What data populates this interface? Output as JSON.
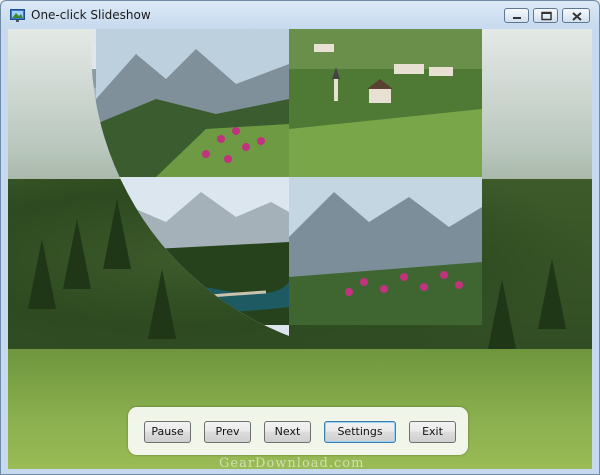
{
  "window": {
    "title": "One-click Slideshow"
  },
  "controls": {
    "pause_label": "Pause",
    "prev_label": "Prev",
    "next_label": "Next",
    "settings_label": "Settings",
    "exit_label": "Exit"
  },
  "watermark": "GearDownload.com",
  "icons": {
    "app": "slideshow-app-icon",
    "minimize": "minimize-icon",
    "maximize": "maximize-icon",
    "close": "close-icon"
  },
  "colors": {
    "titlebar": "#c6d9ee",
    "focused_button_border": "#3c7fb1",
    "lake": "#1e5a62",
    "meadow": "#8bb04f",
    "flowers": "#c0337f"
  }
}
